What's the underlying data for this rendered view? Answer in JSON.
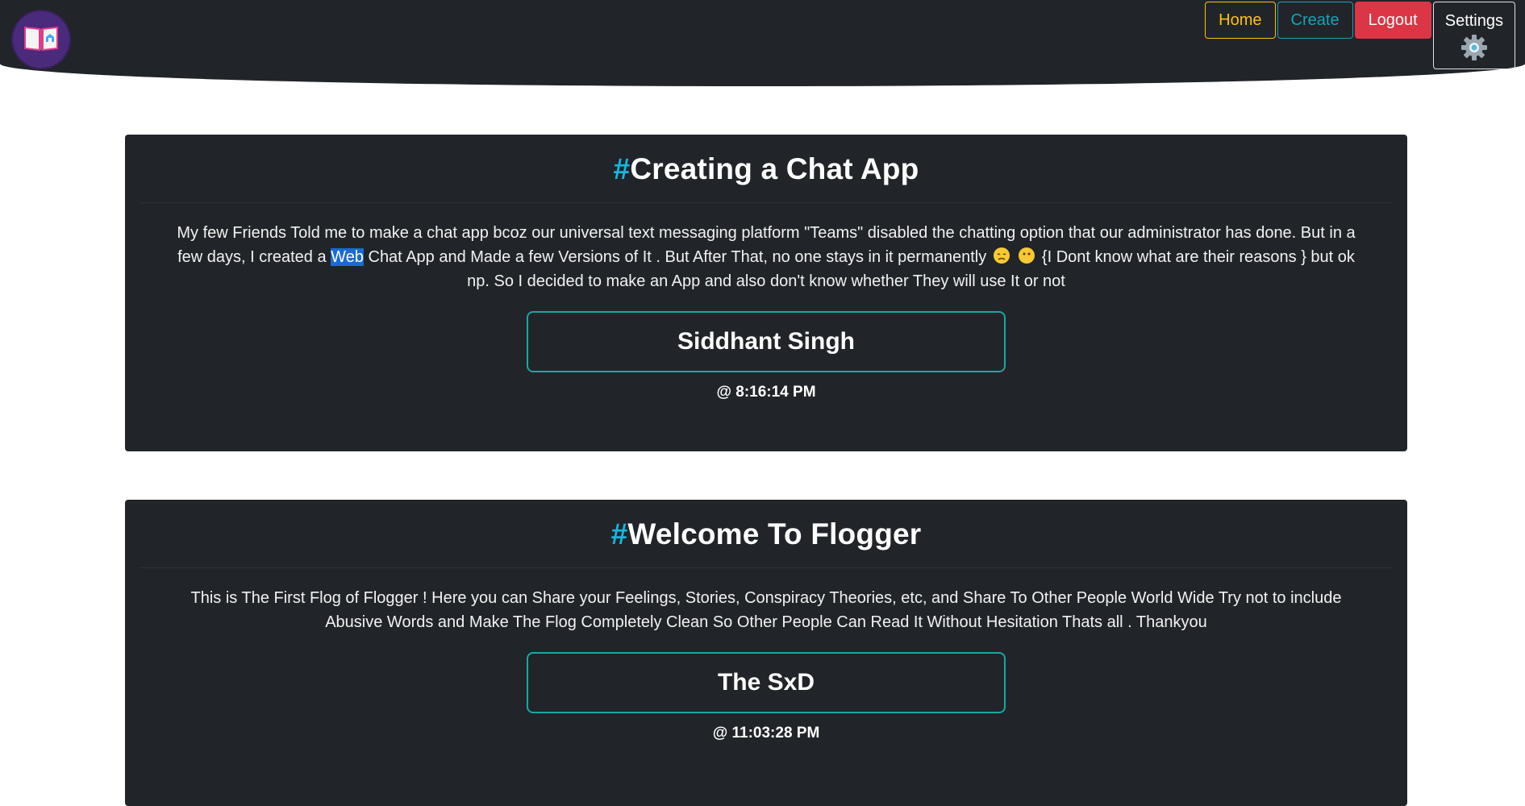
{
  "nav": {
    "home": "Home",
    "create": "Create",
    "logout": "Logout",
    "settings": "Settings",
    "settings_icon": "gear-icon",
    "logo_icon": "book-icon"
  },
  "colors": {
    "accent_hash": "#17b6e0",
    "home": "#ffc107",
    "create": "#17a2b8",
    "logout": "#dc3545",
    "author_border": "#18a8a0"
  },
  "posts": [
    {
      "hash": "#",
      "title": "Creating a Chat App",
      "body_part1": "My few Friends Told me to make a chat app bcoz our universal text messaging platform \"Teams\" disabled the chatting option that our administrator has done. But in a few days, I created a ",
      "body_highlight": "Web",
      "body_part2": " Chat App and Made a few Versions of It . But After That, no one stays in it permanently ",
      "body_part3": " {I Dont know what are their reasons } but ok np. So I decided to make an App and also don't know whether They will use It or not",
      "author": "Siddhant Singh",
      "time": "@ 8:16:14 PM"
    },
    {
      "hash": "#",
      "title": "Welcome To Flogger",
      "body": "This is The First Flog of Flogger ! Here you can Share your Feelings, Stories, Conspiracy Theories, etc, and Share To Other People World Wide Try not to include Abusive Words and Make The Flog Completely Clean So Other People Can Read It Without Hesitation Thats all . Thankyou",
      "author": "The SxD",
      "time": "@ 11:03:28 PM"
    }
  ]
}
